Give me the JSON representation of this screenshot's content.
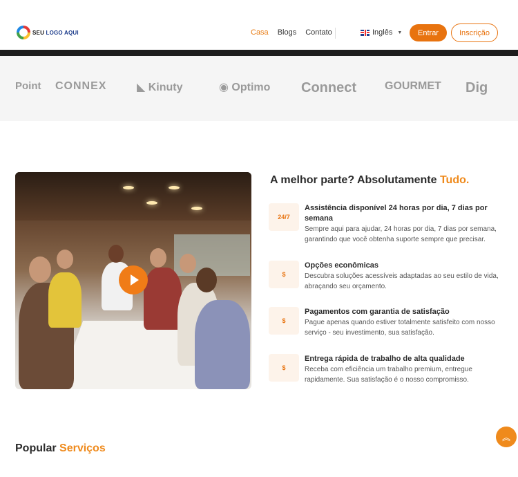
{
  "header": {
    "logo_text_1": "SEU ",
    "logo_text_2": "LOGO AQUI",
    "nav": [
      "Casa",
      "Blogs",
      "Contato"
    ],
    "language": "Inglês",
    "login_label": "Entrar",
    "signup_label": "Inscrição"
  },
  "brands": [
    "Point",
    "CONNEX",
    "Kinuty",
    "Optimo",
    "Connect",
    "GOURMET",
    "Dig"
  ],
  "feature_section": {
    "title_prefix": "A melhor parte? Absolutamente ",
    "title_highlight": "Tudo.",
    "items": [
      {
        "icon": "24-7-support-icon",
        "icon_text": "24/7",
        "title": "Assistência disponível 24 horas por dia, 7 dias por semana",
        "desc": "Sempre aqui para ajudar, 24 horas por dia, 7 dias por semana, garantindo que você obtenha suporte sempre que precisar."
      },
      {
        "icon": "economic-options-icon",
        "icon_text": "$",
        "title": "Opções econômicas",
        "desc": "Descubra soluções acessíveis adaptadas ao seu estilo de vida, abraçando seu orçamento."
      },
      {
        "icon": "payment-guarantee-icon",
        "icon_text": "$",
        "title": "Pagamentos com garantia de satisfação",
        "desc": "Pague apenas quando estiver totalmente satisfeito com nosso serviço - seu investimento, sua satisfação."
      },
      {
        "icon": "fast-delivery-icon",
        "icon_text": "$",
        "title": "Entrega rápida de trabalho de alta qualidade",
        "desc": "Receba com eficiência um trabalho premium, entregue rapidamente. Sua satisfação é o nosso compromisso."
      }
    ]
  },
  "popular": {
    "prefix": "Popular ",
    "highlight": "Serviços"
  },
  "colors": {
    "accent": "#ef8a1c",
    "button": "#e8730f"
  }
}
